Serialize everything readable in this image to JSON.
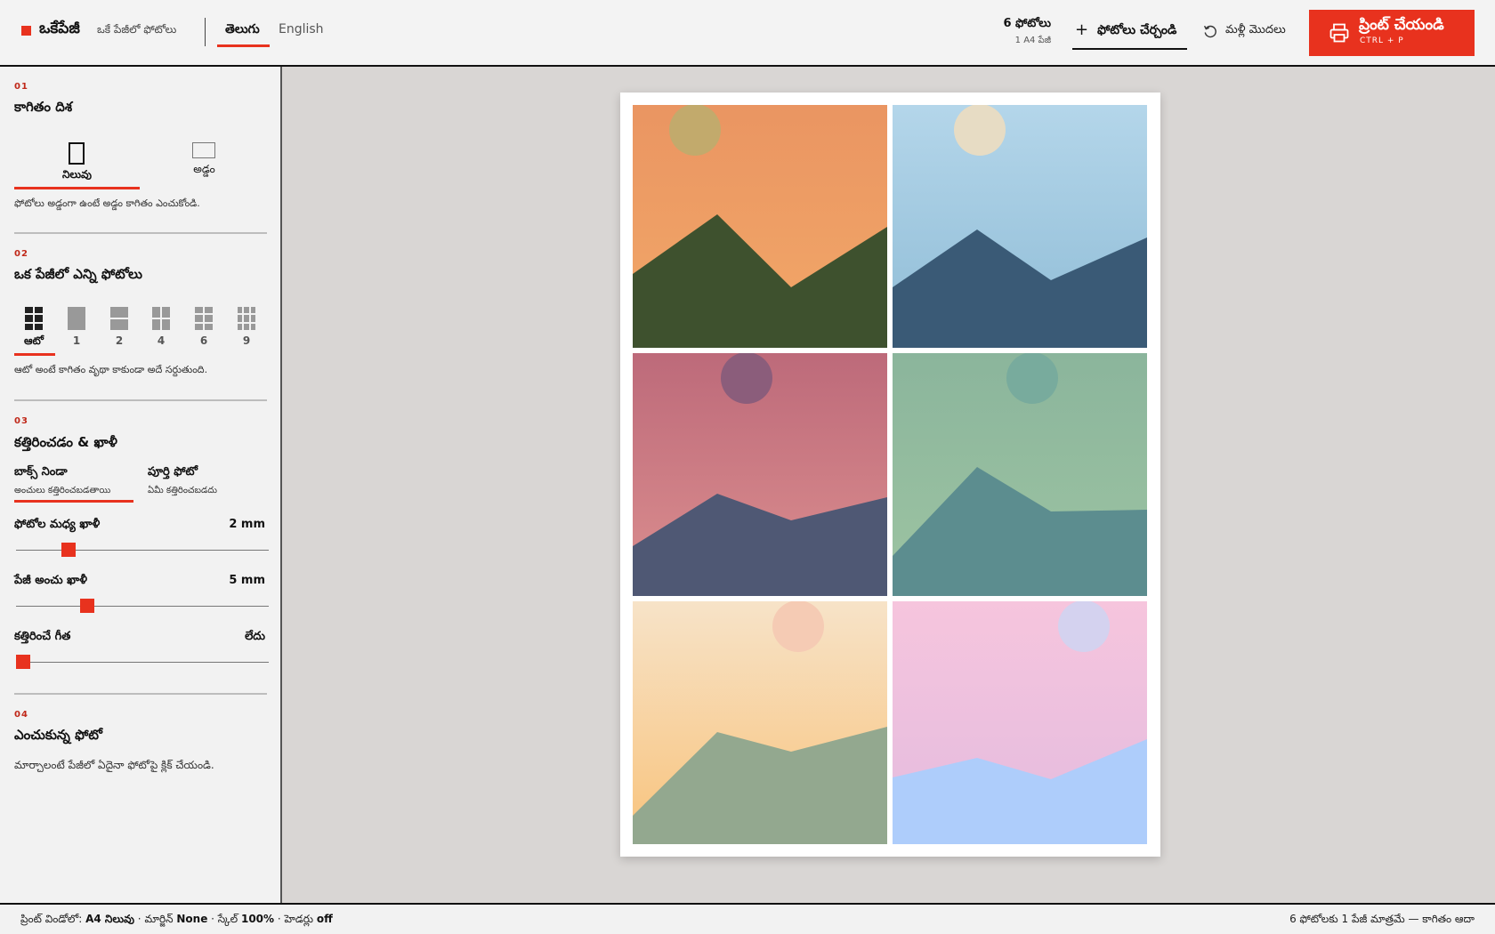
{
  "header": {
    "brand_name": "ఒకేపేజీ",
    "brand_tagline": "ఒకే పేజీలో ఫోటోలు",
    "languages": [
      "తెలుగు",
      "English"
    ],
    "active_language": "తెలుగు",
    "photo_count": "6 ఫోటోలు",
    "page_count": "1 A4 పేజీ",
    "add_photos_label": "ఫోటోలు చేర్చండి",
    "reset_label": "మళ్లీ మొదలు",
    "print_label": "ప్రింట్ చేయండి",
    "print_shortcut": "CTRL + P",
    "accent_color": "#e8321e"
  },
  "sidebar": {
    "orientation": {
      "num": "01",
      "title": "కాగితం దిశ",
      "options": [
        "నిలువు",
        "అడ్డం"
      ],
      "selected": "నిలువు",
      "hint": "ఫోటోలు అడ్డంగా ఉంటే అడ్డం కాగితం ఎంచుకోండి."
    },
    "per_page": {
      "num": "02",
      "title": "ఒక పేజీలో ఎన్ని ఫోటోలు",
      "options": [
        "ఆటో",
        "1",
        "2",
        "4",
        "6",
        "9"
      ],
      "selected": "ఆటో",
      "hint": "ఆటో అంటే కాగితం వృథా కాకుండా అదే సర్దుతుంది."
    },
    "fit": {
      "num": "03",
      "title": "కత్తిరించడం & ఖాళీ",
      "options": [
        {
          "label": "బాక్స్ నిండా",
          "sub": "అంచులు కత్తిరించబడతాయి"
        },
        {
          "label": "పూర్తి ఫోటో",
          "sub": "ఏమీ కత్తిరించబడదు"
        }
      ],
      "selected": "బాక్స్ నిండా",
      "gap_label": "ఫోటోల మధ్య ఖాళీ",
      "gap_value": "2 mm",
      "gap_fraction": 0.19,
      "margin_label": "పేజీ అంచు ఖాళీ",
      "margin_value": "5 mm",
      "margin_fraction": 0.27,
      "cutline_label": "కత్తిరించే గీత",
      "cutline_value": "లేదు",
      "cutline_fraction": 0.0
    },
    "selected_photo": {
      "num": "04",
      "title": "ఎంచుకున్న ఫోటో",
      "hint": "మార్చాలంటే పేజీలో ఏదైనా ఫోటోపై క్లిక్ చేయండి."
    }
  },
  "photos": [
    {
      "sky_top": "#ea9562",
      "sky_bottom": "#f2a868",
      "sun": "#c2aa6c",
      "mountain": "#3e512e"
    },
    {
      "sky_top": "#b4d6ea",
      "sky_bottom": "#8fbcd6",
      "sun": "#e7dcc4",
      "mountain": "#3a5a76"
    },
    {
      "sky_top": "#bd6a7a",
      "sky_bottom": "#dc8f8f",
      "sun": "#8b5d7b",
      "mountain": "#4f5874"
    },
    {
      "sky_top": "#8bb59c",
      "sky_bottom": "#9dc4a2",
      "sun": "#78ab9d",
      "mountain": "#5c8d8f"
    },
    {
      "sky_top": "#f7e3c8",
      "sky_bottom": "#f8c37c",
      "sun": "#f5cbb4",
      "mountain": "#93a88f"
    },
    {
      "sky_top": "#f6c5dd",
      "sky_bottom": "#e3bbdf",
      "sun": "#d4d2ef",
      "mountain": "#aecdfb"
    }
  ],
  "status": {
    "left_prefix": "ప్రింట్ విండోలో:",
    "paper": "A4 నిలువు",
    "margin_label": "మార్జిన్",
    "margin": "None",
    "scale_label": "స్కేల్",
    "scale": "100%",
    "headers_label": "హెడర్లు",
    "headers": "off",
    "right": "6 ఫోటోలకు 1 పేజీ మాత్రమే — కాగితం ఆదా"
  }
}
